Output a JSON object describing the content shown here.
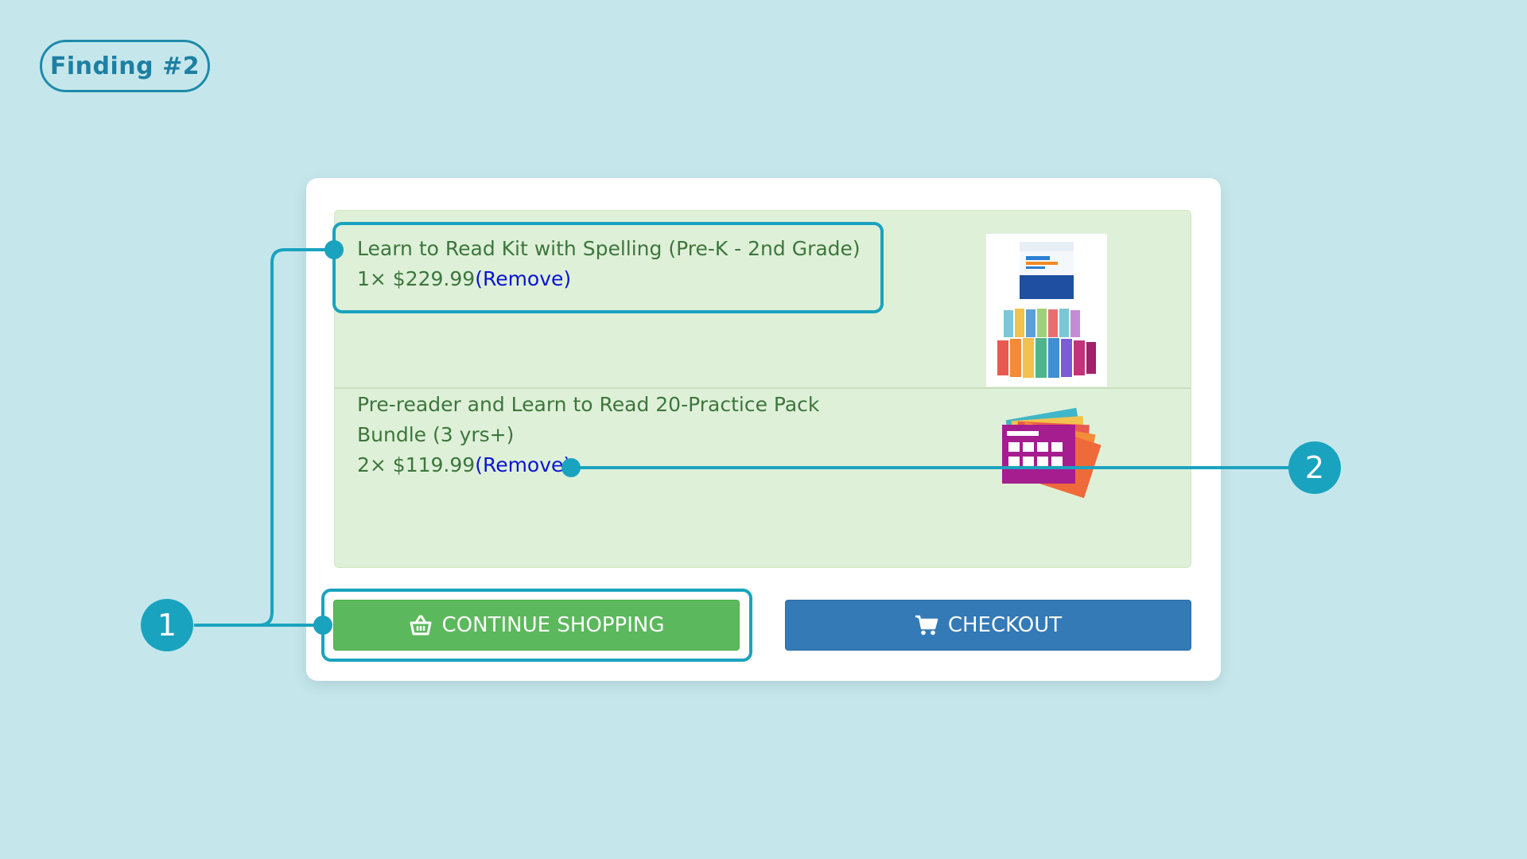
{
  "finding": {
    "label": "Finding #2"
  },
  "cart": {
    "items": [
      {
        "name": "Learn to Read Kit with Spelling (Pre-K - 2nd Grade)",
        "qty_price": "1× $229.99",
        "remove_label": "(Remove)"
      },
      {
        "name_line1": "Pre-reader and Learn to Read 20-Practice Pack",
        "name_line2": "Bundle (3 yrs+)",
        "qty_price": "2× $119.99",
        "remove_label": "(Remove)"
      }
    ]
  },
  "buttons": {
    "continue_label": "CONTINUE SHOPPING",
    "checkout_label": "CHECKOUT"
  },
  "callouts": [
    {
      "number": "1"
    },
    {
      "number": "2"
    }
  ],
  "colors": {
    "background": "#c5e7ec",
    "annotation": "#1aa3bf",
    "continue_button": "#5cb85c",
    "checkout_button": "#337ab7",
    "cart_item_bg": "#dff0d8",
    "cart_text": "#3c763d",
    "link": "#0a14d0"
  },
  "icons": {
    "continue": "shopping-basket-icon",
    "checkout": "shopping-cart-icon"
  }
}
